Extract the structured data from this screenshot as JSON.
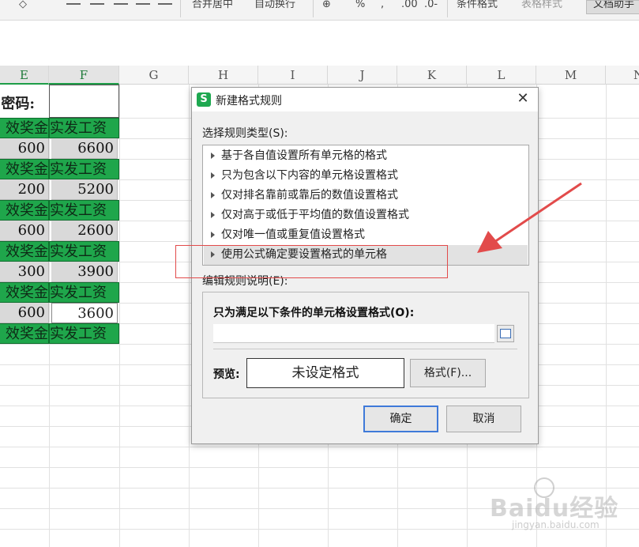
{
  "ribbon": {
    "center_merge": "合并居中",
    "wrap_text": "自动换行",
    "percent": "%",
    "decimal_inc": ".00",
    "decimal_dec": ".0-",
    "cond_format": "条件格式",
    "table_style": "表格样式",
    "doc_helper": "文档助手"
  },
  "columns": [
    "E",
    "F",
    "G",
    "H",
    "I",
    "J",
    "K",
    "L",
    "M",
    "N"
  ],
  "sheet": {
    "row1_label": "密码:",
    "header_bonus": "效奖金",
    "header_pay": "实发工资",
    "rows": [
      {
        "bonus": "600",
        "pay": "6600"
      },
      {
        "bonus": "200",
        "pay": "5200"
      },
      {
        "bonus": "600",
        "pay": "2600"
      },
      {
        "bonus": "300",
        "pay": "3900"
      },
      {
        "bonus": "600",
        "pay": "3600"
      }
    ]
  },
  "dialog": {
    "title": "新建格式规则",
    "icon_letter": "S",
    "select_type_label": "选择规则类型(S):",
    "rule_types": [
      "基于各自值设置所有单元格的格式",
      "只为包含以下内容的单元格设置格式",
      "仅对排名靠前或靠后的数值设置格式",
      "仅对高于或低于平均值的数值设置格式",
      "仅对唯一值或重复值设置格式",
      "使用公式确定要设置格式的单元格"
    ],
    "edit_desc_label": "编辑规则说明(E):",
    "condition_title": "只为满足以下条件的单元格设置格式(O):",
    "formula_value": "",
    "preview_label": "预览:",
    "preview_text": "未设定格式",
    "format_button": "格式(F)...",
    "ok_button": "确定",
    "cancel_button": "取消"
  },
  "watermark": {
    "brand": "Baidu经验",
    "url": "jingyan.baidu.com"
  },
  "colors": {
    "green_fill": "#1fa64b",
    "annotation_red": "#e24b4b",
    "ok_border": "#3f7ad9"
  }
}
